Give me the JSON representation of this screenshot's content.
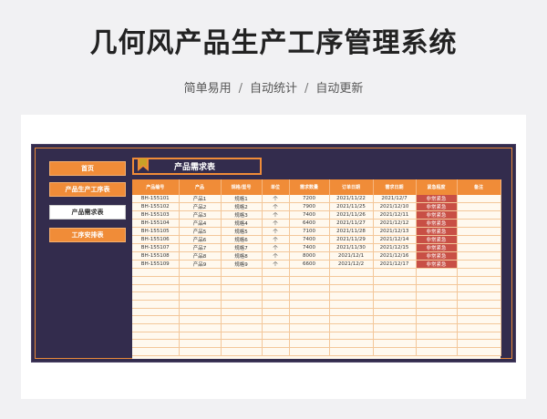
{
  "header": {
    "title": "几何风产品生产工序管理系统",
    "subtitle_items": [
      "简单易用",
      "自动统计",
      "自动更新"
    ],
    "subtitle_sep": "/"
  },
  "sidebar": {
    "items": [
      {
        "label": "首页",
        "active": false
      },
      {
        "label": "产品生产工序表",
        "active": false
      },
      {
        "label": "产品需求表",
        "active": true
      },
      {
        "label": "工序安排表",
        "active": false
      }
    ]
  },
  "tab": {
    "title": "产品需求表"
  },
  "table": {
    "columns": [
      "产品编号",
      "产品",
      "规格/型号",
      "单位",
      "需求数量",
      "订单日期",
      "需求日期",
      "紧急程度",
      "备注"
    ],
    "rows": [
      [
        "BH-155101",
        "产品1",
        "规格1",
        "个",
        "7200",
        "2021/11/22",
        "2021/12/7",
        "非常紧急",
        ""
      ],
      [
        "BH-155102",
        "产品2",
        "规格2",
        "个",
        "7900",
        "2021/11/25",
        "2021/12/10",
        "非常紧急",
        ""
      ],
      [
        "BH-155103",
        "产品3",
        "规格3",
        "个",
        "7400",
        "2021/11/26",
        "2021/12/11",
        "非常紧急",
        ""
      ],
      [
        "BH-155104",
        "产品4",
        "规格4",
        "个",
        "6400",
        "2021/11/27",
        "2021/12/12",
        "非常紧急",
        ""
      ],
      [
        "BH-155105",
        "产品5",
        "规格5",
        "个",
        "7100",
        "2021/11/28",
        "2021/12/13",
        "非常紧急",
        ""
      ],
      [
        "BH-155106",
        "产品6",
        "规格6",
        "个",
        "7400",
        "2021/11/29",
        "2021/12/14",
        "非常紧急",
        ""
      ],
      [
        "BH-155107",
        "产品7",
        "规格7",
        "个",
        "7400",
        "2021/11/30",
        "2021/12/15",
        "非常紧急",
        ""
      ],
      [
        "BH-155108",
        "产品8",
        "规格8",
        "个",
        "8000",
        "2021/12/1",
        "2021/12/16",
        "非常紧急",
        ""
      ],
      [
        "BH-155109",
        "产品9",
        "规格9",
        "个",
        "6600",
        "2021/12/2",
        "2021/12/17",
        "非常紧急",
        ""
      ]
    ],
    "empty_rows": 11
  },
  "colors": {
    "accent": "#f08c38",
    "panel_bg": "#332c4d",
    "urgent": "#c84f45",
    "table_bg": "#fff9ef"
  }
}
